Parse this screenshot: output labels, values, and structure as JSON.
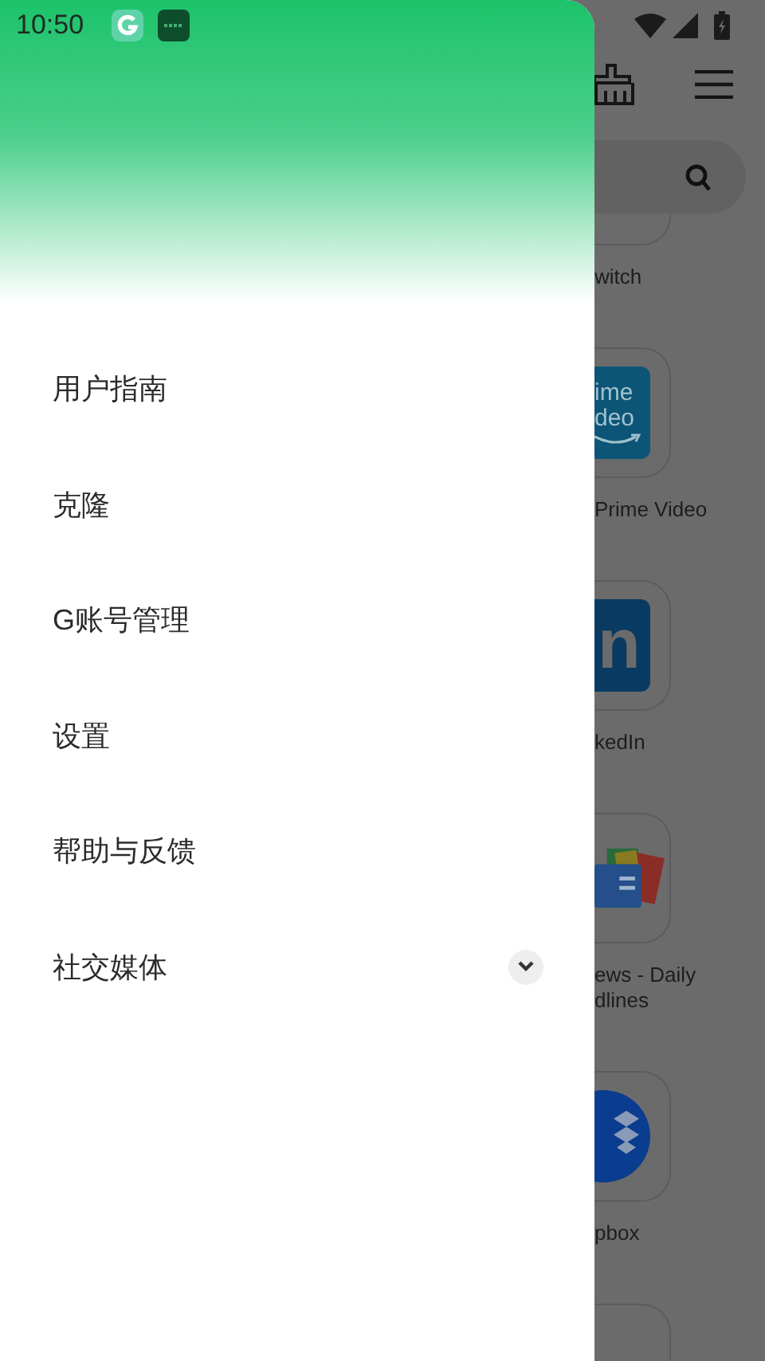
{
  "status_bar": {
    "time": "10:50"
  },
  "drawer": {
    "items": [
      {
        "label": "用户指南",
        "kind": "link"
      },
      {
        "label": "克隆",
        "kind": "link"
      },
      {
        "label": "G账号管理",
        "kind": "link"
      },
      {
        "label": "设置",
        "kind": "link"
      },
      {
        "label": "帮助与反馈",
        "kind": "link"
      },
      {
        "label": "社交媒体",
        "kind": "expandable",
        "expanded": false
      }
    ]
  },
  "background_app": {
    "tiles": [
      {
        "kind": "clipped",
        "label_lines": [
          "witch"
        ]
      },
      {
        "kind": "prime",
        "icon_text": [
          "ime",
          "deo"
        ],
        "label_lines": [
          "Prime Video"
        ]
      },
      {
        "kind": "linkedin",
        "icon_text": [
          "n"
        ],
        "label_lines": [
          "kedIn"
        ]
      },
      {
        "kind": "news",
        "label_lines": [
          "ews - Daily",
          "dlines"
        ]
      },
      {
        "kind": "dropbox",
        "label_lines": [
          "pbox"
        ]
      },
      {
        "kind": "partial"
      }
    ]
  }
}
